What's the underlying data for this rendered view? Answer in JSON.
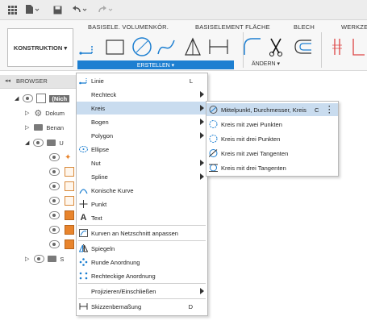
{
  "ribbon": {
    "tabs": [
      "BASISELE. VOLUMENKÖR.",
      "BASISELEMENT FLÄCHE",
      "BLECH",
      "WERKZE"
    ],
    "workspace_label": "KONSTRUKTION ▾",
    "create_group": "ERSTELLEN ▾",
    "modify_group": "ÄNDERN ▾"
  },
  "browser": {
    "title": "BROWSER",
    "root_label": "(Nich",
    "items": [
      "Dokum",
      "Benan",
      "U",
      "S"
    ]
  },
  "create_menu": {
    "items": [
      {
        "label": "Linie",
        "shortcut": "L",
        "icon": "line-icon",
        "arrow": false
      },
      {
        "label": "Rechteck",
        "shortcut": "",
        "icon": "rectangle-icon",
        "arrow": true
      },
      {
        "label": "Kreis",
        "shortcut": "",
        "icon": "circle-icon",
        "arrow": true
      },
      {
        "label": "Bogen",
        "shortcut": "",
        "icon": "arc-icon",
        "arrow": true
      },
      {
        "label": "Polygon",
        "shortcut": "",
        "icon": "polygon-icon",
        "arrow": true
      },
      {
        "label": "Ellipse",
        "shortcut": "",
        "icon": "ellipse-icon",
        "arrow": false
      },
      {
        "label": "Nut",
        "shortcut": "",
        "icon": "slot-icon",
        "arrow": true
      },
      {
        "label": "Spline",
        "shortcut": "",
        "icon": "spline-icon",
        "arrow": true
      },
      {
        "label": "Konische Kurve",
        "shortcut": "",
        "icon": "conic-curve-icon",
        "arrow": false
      },
      {
        "label": "Punkt",
        "shortcut": "",
        "icon": "point-icon",
        "arrow": false
      },
      {
        "label": "Text",
        "shortcut": "",
        "icon": "text-icon",
        "arrow": false
      },
      {
        "label": "Kurven an Netzschnitt anpassen",
        "shortcut": "",
        "icon": "fit-curves-icon",
        "arrow": false
      },
      {
        "label": "Spiegeln",
        "shortcut": "",
        "icon": "mirror-icon",
        "arrow": false
      },
      {
        "label": "Runde Anordnung",
        "shortcut": "",
        "icon": "circular-pattern-icon",
        "arrow": false
      },
      {
        "label": "Rechteckige Anordnung",
        "shortcut": "",
        "icon": "rectangular-pattern-icon",
        "arrow": false
      },
      {
        "label": "Projizieren/Einschließen",
        "shortcut": "",
        "icon": "",
        "arrow": true
      },
      {
        "label": "Skizzenbemaßung",
        "shortcut": "D",
        "icon": "sketch-dimension-icon",
        "arrow": false
      }
    ]
  },
  "circle_submenu": {
    "items": [
      {
        "label": "Mittelpunkt, Durchmesser, Kreis",
        "shortcut": "C"
      },
      {
        "label": "Kreis mit zwei Punkten",
        "shortcut": ""
      },
      {
        "label": "Kreis mit drei Punkten",
        "shortcut": ""
      },
      {
        "label": "Kreis mit zwei Tangenten",
        "shortcut": ""
      },
      {
        "label": "Kreis mit drei Tangenten",
        "shortcut": ""
      }
    ]
  },
  "colors": {
    "accent": "#1d7fd1",
    "highlight": "#c9dcef",
    "sketch": "#e8842c"
  }
}
